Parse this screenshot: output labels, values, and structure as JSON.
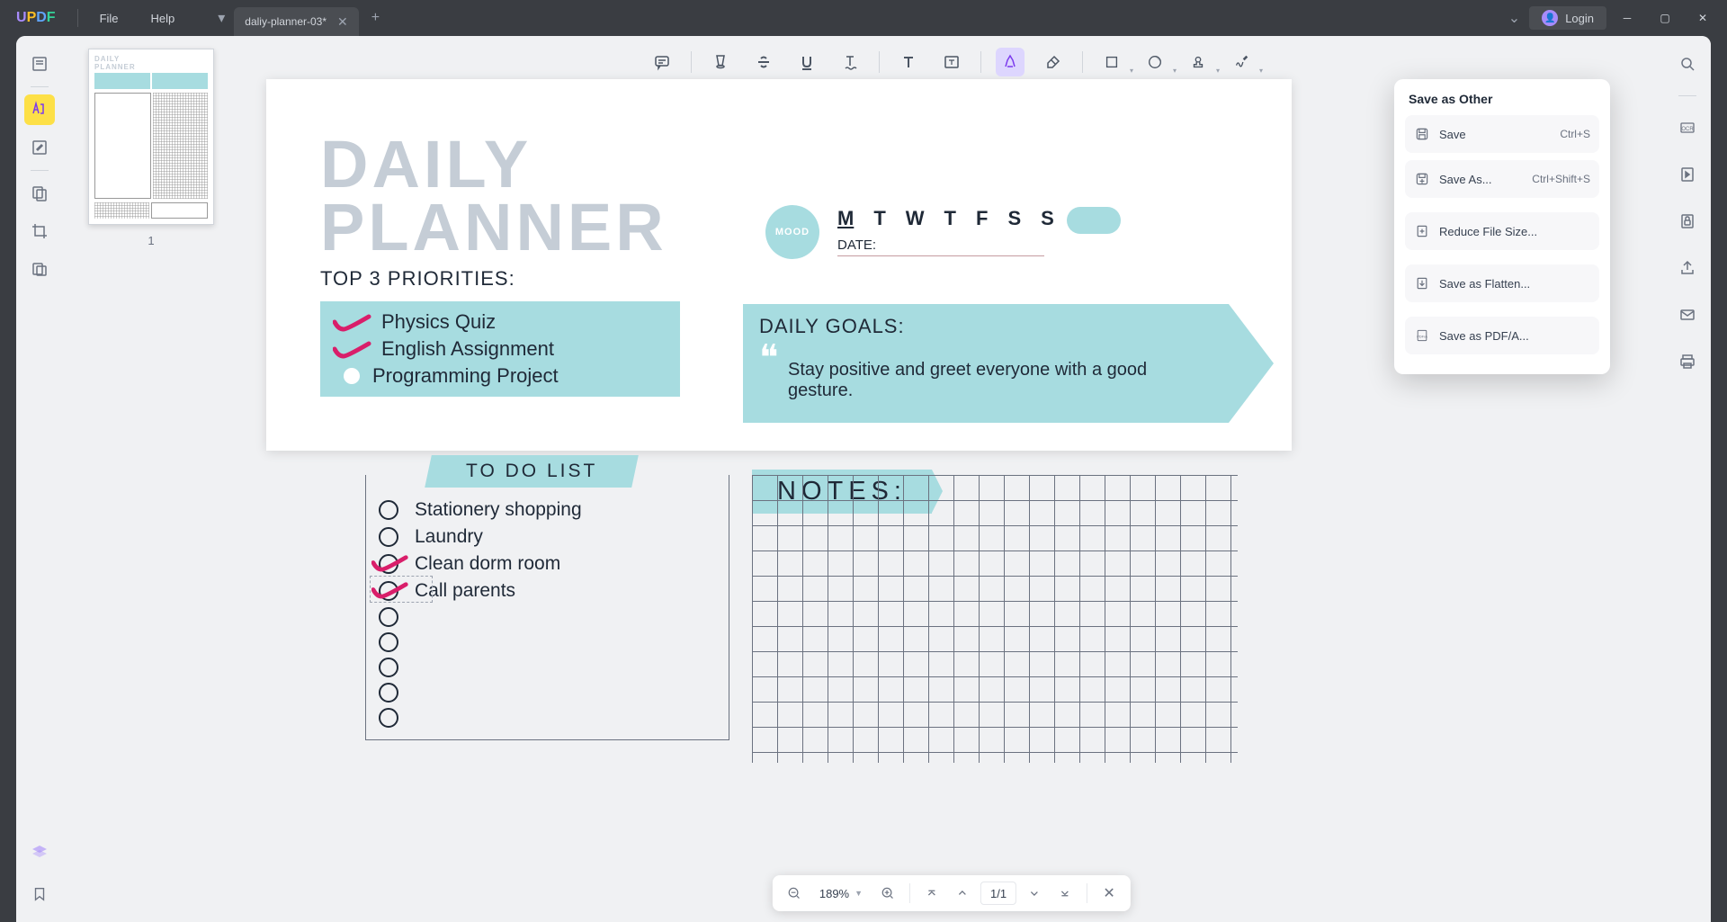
{
  "app": {
    "logo": "UPDF"
  },
  "menu": {
    "file": "File",
    "help": "Help"
  },
  "tab": {
    "title": "daliy-planner-03*"
  },
  "login": {
    "label": "Login"
  },
  "thumbnail": {
    "page_num": "1"
  },
  "save_popup": {
    "title": "Save as Other",
    "save": "Save",
    "save_shortcut": "Ctrl+S",
    "save_as": "Save As...",
    "save_as_shortcut": "Ctrl+Shift+S",
    "reduce": "Reduce File Size...",
    "flatten": "Save as Flatten...",
    "pdfa": "Save as PDF/A..."
  },
  "bottombar": {
    "zoom": "189%",
    "page_current": "1",
    "page_sep": " / ",
    "page_total": "1"
  },
  "doc": {
    "title1": "DAILY",
    "title2": "PLANNER",
    "priorities_label": "TOP 3 PRIORITIES:",
    "mood": "MOOD",
    "weekdays": [
      "M",
      "T",
      "W",
      "T",
      "F",
      "S",
      "S"
    ],
    "date_label": "DATE:",
    "priorities": [
      {
        "text": "Physics Quiz",
        "checked": true
      },
      {
        "text": "English Assignment",
        "checked": true
      },
      {
        "text": "Programming Project",
        "checked": false
      }
    ],
    "goals_label": "DAILY GOALS:",
    "goals_text": "Stay positive and greet everyone with a good gesture.",
    "todo_label": "TO DO LIST",
    "todos": [
      {
        "text": "Stationery shopping",
        "checked": false
      },
      {
        "text": "Laundry",
        "checked": false
      },
      {
        "text": "Clean dorm room",
        "checked": true
      },
      {
        "text": "Call parents",
        "checked": true
      },
      {
        "text": "",
        "checked": false
      },
      {
        "text": "",
        "checked": false
      },
      {
        "text": "",
        "checked": false
      },
      {
        "text": "",
        "checked": false
      },
      {
        "text": "",
        "checked": false
      }
    ],
    "notes_label": "NOTES:"
  }
}
